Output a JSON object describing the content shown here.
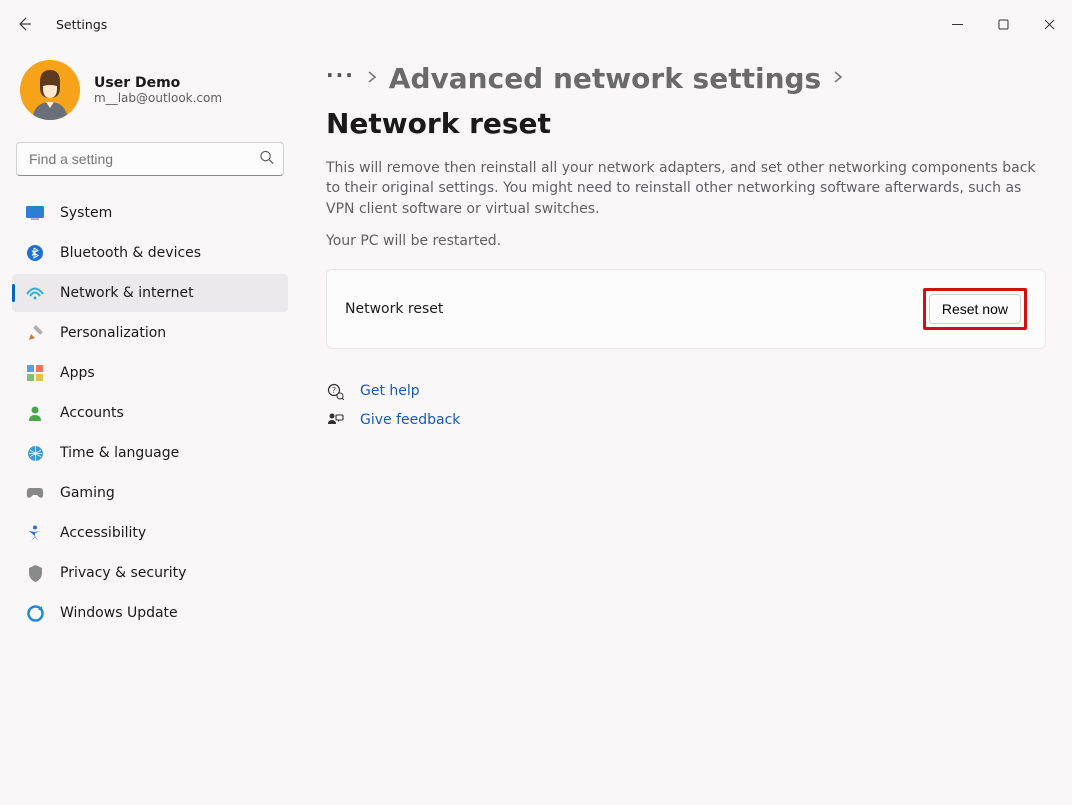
{
  "titlebar": {
    "app_title": "Settings"
  },
  "profile": {
    "name": "User Demo",
    "email": "m__lab@outlook.com"
  },
  "search": {
    "placeholder": "Find a setting"
  },
  "sidebar": {
    "items": [
      {
        "label": "System",
        "icon": "system"
      },
      {
        "label": "Bluetooth & devices",
        "icon": "bluetooth"
      },
      {
        "label": "Network & internet",
        "icon": "network",
        "selected": true
      },
      {
        "label": "Personalization",
        "icon": "personalization"
      },
      {
        "label": "Apps",
        "icon": "apps"
      },
      {
        "label": "Accounts",
        "icon": "accounts"
      },
      {
        "label": "Time & language",
        "icon": "time"
      },
      {
        "label": "Gaming",
        "icon": "gaming"
      },
      {
        "label": "Accessibility",
        "icon": "accessibility"
      },
      {
        "label": "Privacy & security",
        "icon": "privacy"
      },
      {
        "label": "Windows Update",
        "icon": "update"
      }
    ]
  },
  "breadcrumb": {
    "parent": "Advanced network settings",
    "current": "Network reset"
  },
  "main": {
    "description": "This will remove then reinstall all your network adapters, and set other networking components back to their original settings. You might need to reinstall other networking software afterwards, such as VPN client software or virtual switches.",
    "restart_note": "Your PC will be restarted.",
    "card_label": "Network reset",
    "reset_button": "Reset now",
    "help_link": "Get help",
    "feedback_link": "Give feedback"
  }
}
